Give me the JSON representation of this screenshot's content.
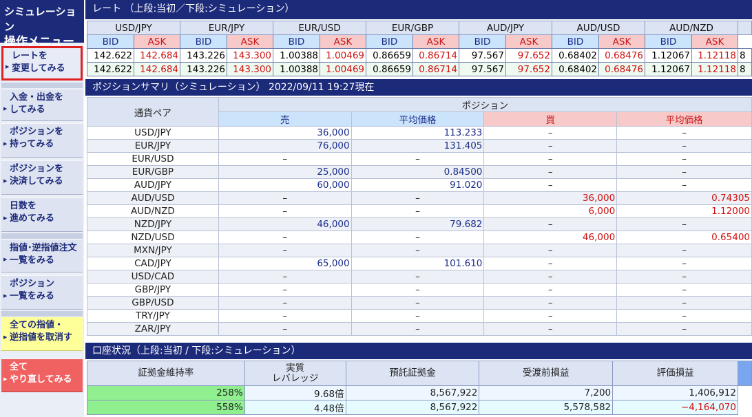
{
  "sidebar": {
    "title_line1": "シミュレーション",
    "title_line2": "操作メニュー",
    "buttons": [
      {
        "l1": "レートを",
        "l2": "変更してみる"
      },
      {
        "l1": "入金・出金を",
        "l2": "してみる"
      },
      {
        "l1": "ポジションを",
        "l2": "持ってみる"
      },
      {
        "l1": "ポジションを",
        "l2": "決済してみる"
      },
      {
        "l1": "日数を",
        "l2": "進めてみる"
      },
      {
        "l1": "指値･逆指値注文",
        "l2": "一覧をみる"
      },
      {
        "l1": "ポジション",
        "l2": "一覧をみる"
      },
      {
        "l1": "全ての指値・",
        "l2": "逆指値を取消す"
      },
      {
        "l1": "全て",
        "l2": "やり直してみる"
      }
    ]
  },
  "rates": {
    "title": "レート （上段:当初／下段:シミュレーション）",
    "bid_label": "BID",
    "ask_label": "ASK",
    "pairs": [
      "USD/JPY",
      "EUR/JPY",
      "EUR/USD",
      "EUR/GBP",
      "AUD/JPY",
      "AUD/USD",
      "AUD/NZD"
    ],
    "initial": [
      [
        "142.622",
        "142.684"
      ],
      [
        "143.226",
        "143.300"
      ],
      [
        "1.00388",
        "1.00469"
      ],
      [
        "0.86659",
        "0.86714"
      ],
      [
        "97.567",
        "97.652"
      ],
      [
        "0.68402",
        "0.68476"
      ],
      [
        "1.12067",
        "1.12118"
      ]
    ],
    "simulation": [
      [
        "142.622",
        "142.684"
      ],
      [
        "143.226",
        "143.300"
      ],
      [
        "1.00388",
        "1.00469"
      ],
      [
        "0.86659",
        "0.86714"
      ],
      [
        "97.567",
        "97.652"
      ],
      [
        "0.68402",
        "0.68476"
      ],
      [
        "1.12067",
        "1.12118"
      ]
    ],
    "overflow_left": "8",
    "overflow_left2": "8"
  },
  "positions": {
    "title": "ポジションサマリ（シミュレーション） 2022/09/11 19:27現在",
    "header_pair": "通貨ペア",
    "header_position": "ポジション",
    "header_sell": "売",
    "header_avg": "平均価格",
    "header_buy": "買",
    "header_avg2": "平均価格",
    "rows": [
      {
        "pair": "USD/JPY",
        "sell": "36,000",
        "sell_avg": "113.233",
        "buy": "–",
        "buy_avg": "–"
      },
      {
        "pair": "EUR/JPY",
        "sell": "76,000",
        "sell_avg": "131.405",
        "buy": "–",
        "buy_avg": "–"
      },
      {
        "pair": "EUR/USD",
        "sell": "–",
        "sell_avg": "–",
        "buy": "–",
        "buy_avg": "–"
      },
      {
        "pair": "EUR/GBP",
        "sell": "25,000",
        "sell_avg": "0.84500",
        "buy": "–",
        "buy_avg": "–"
      },
      {
        "pair": "AUD/JPY",
        "sell": "60,000",
        "sell_avg": "91.020",
        "buy": "–",
        "buy_avg": "–"
      },
      {
        "pair": "AUD/USD",
        "sell": "–",
        "sell_avg": "–",
        "buy": "36,000",
        "buy_avg": "0.74305"
      },
      {
        "pair": "AUD/NZD",
        "sell": "–",
        "sell_avg": "–",
        "buy": "6,000",
        "buy_avg": "1.12000"
      },
      {
        "pair": "NZD/JPY",
        "sell": "46,000",
        "sell_avg": "79.682",
        "buy": "–",
        "buy_avg": "–"
      },
      {
        "pair": "NZD/USD",
        "sell": "–",
        "sell_avg": "–",
        "buy": "46,000",
        "buy_avg": "0.65400"
      },
      {
        "pair": "MXN/JPY",
        "sell": "–",
        "sell_avg": "–",
        "buy": "–",
        "buy_avg": "–"
      },
      {
        "pair": "CAD/JPY",
        "sell": "65,000",
        "sell_avg": "101.610",
        "buy": "–",
        "buy_avg": "–"
      },
      {
        "pair": "USD/CAD",
        "sell": "–",
        "sell_avg": "–",
        "buy": "–",
        "buy_avg": "–"
      },
      {
        "pair": "GBP/JPY",
        "sell": "–",
        "sell_avg": "–",
        "buy": "–",
        "buy_avg": "–"
      },
      {
        "pair": "GBP/USD",
        "sell": "–",
        "sell_avg": "–",
        "buy": "–",
        "buy_avg": "–"
      },
      {
        "pair": "TRY/JPY",
        "sell": "–",
        "sell_avg": "–",
        "buy": "–",
        "buy_avg": "–"
      },
      {
        "pair": "ZAR/JPY",
        "sell": "–",
        "sell_avg": "–",
        "buy": "–",
        "buy_avg": "–"
      }
    ]
  },
  "account": {
    "title": "口座状況（上段:当初 / 下段:シミュレーション）",
    "h_margin_rate": "証拠金維持率",
    "h_leverage_1": "実質",
    "h_leverage_2": "レバレッジ",
    "h_deposit": "預託証拠金",
    "h_pre_pl": "受渡前損益",
    "h_eval_pl": "評価損益",
    "rows": [
      {
        "rate": "258%",
        "leverage": "9.68倍",
        "deposit": "8,567,922",
        "pre_pl": "7,200",
        "eval_pl": "1,406,912"
      },
      {
        "rate": "558%",
        "leverage": "4.48倍",
        "deposit": "8,567,922",
        "pre_pl": "5,578,582",
        "eval_pl": "−4,164,070"
      }
    ]
  }
}
